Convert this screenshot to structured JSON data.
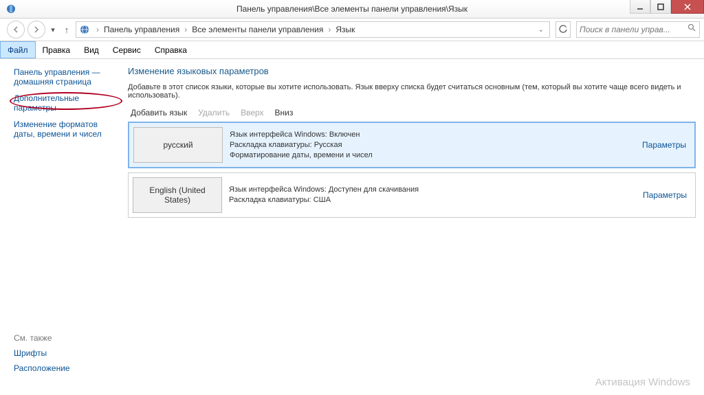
{
  "window": {
    "title": "Панель управления\\Все элементы панели управления\\Язык"
  },
  "breadcrumb": {
    "seg1": "Панель управления",
    "seg2": "Все элементы панели управления",
    "seg3": "Язык"
  },
  "search": {
    "placeholder": "Поиск в панели управ..."
  },
  "menu": {
    "file": "Файл",
    "edit": "Правка",
    "view": "Вид",
    "service": "Сервис",
    "help": "Справка"
  },
  "sidebar": {
    "home": "Панель управления — домашняя страница",
    "adv": "Дополнительные параметры",
    "fmt": "Изменение форматов даты, времени и чисел",
    "seealso": "См. также",
    "fonts": "Шрифты",
    "location": "Расположение"
  },
  "main": {
    "heading": "Изменение языковых параметров",
    "desc": "Добавьте в этот список языки, которые вы хотите использовать. Язык вверху списка будет считаться основным (тем, который вы хотите чаще всего видеть и использовать)."
  },
  "toolbar": {
    "add": "Добавить язык",
    "del": "Удалить",
    "up": "Вверх",
    "down": "Вниз"
  },
  "langs": [
    {
      "name": "русский",
      "line1": "Язык интерфейса Windows: Включен",
      "line2": "Раскладка клавиатуры: Русская",
      "line3": "Форматирование даты, времени и чисел",
      "params": "Параметры"
    },
    {
      "name": "English (United States)",
      "line1": "Язык интерфейса Windows: Доступен для скачивания",
      "line2": "Раскладка клавиатуры: США",
      "line3": "",
      "params": "Параметры"
    }
  ],
  "watermark": "Активация Windows"
}
